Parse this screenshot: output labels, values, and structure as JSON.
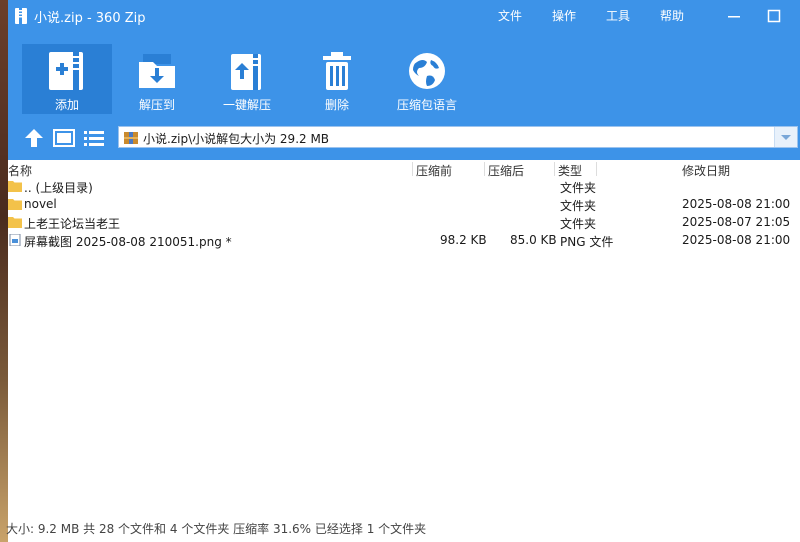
{
  "window": {
    "title": "小说.zip - 360 Zip",
    "menu": [
      "文件",
      "操作",
      "工具",
      "帮助"
    ]
  },
  "toolbar": {
    "buttons": [
      {
        "label": "添加",
        "icon": "add-archive-icon"
      },
      {
        "label": "解压到",
        "icon": "extract-to-icon"
      },
      {
        "label": "一键解压",
        "icon": "one-click-extract-icon"
      },
      {
        "label": "删除",
        "icon": "trash-icon"
      },
      {
        "label": "压缩包语言",
        "icon": "globe-icon"
      }
    ]
  },
  "address": {
    "path": "小说.zip\\小说解包大小为 29.2 MB"
  },
  "columns": [
    "名称",
    "压缩前",
    "压缩后",
    "类型",
    "修改日期"
  ],
  "files": [
    {
      "name": ".. (上级目录)",
      "before": "",
      "after": "",
      "type": "文件夹",
      "modified": ""
    },
    {
      "name": "novel",
      "before": "",
      "after": "",
      "type": "文件夹",
      "modified": "2025-08-08 21:00"
    },
    {
      "name": "上老王论坛当老王",
      "before": "",
      "after": "",
      "type": "文件夹",
      "modified": "2025-08-07 21:05"
    },
    {
      "name": "屏幕截图 2025-08-08 210051.png *",
      "before": "98.2 KB",
      "after": "85.0 KB",
      "type": "PNG 文件",
      "modified": "2025-08-08 21:00"
    }
  ],
  "status": "大小: 9.2 MB 共 28 个文件和 4 个文件夹 压缩率 31.6% 已经选择 1 个文件夹",
  "colors": {
    "accent": "#3d93e8",
    "active_button": "#2a7fd5",
    "folder": "#f3c24a"
  }
}
